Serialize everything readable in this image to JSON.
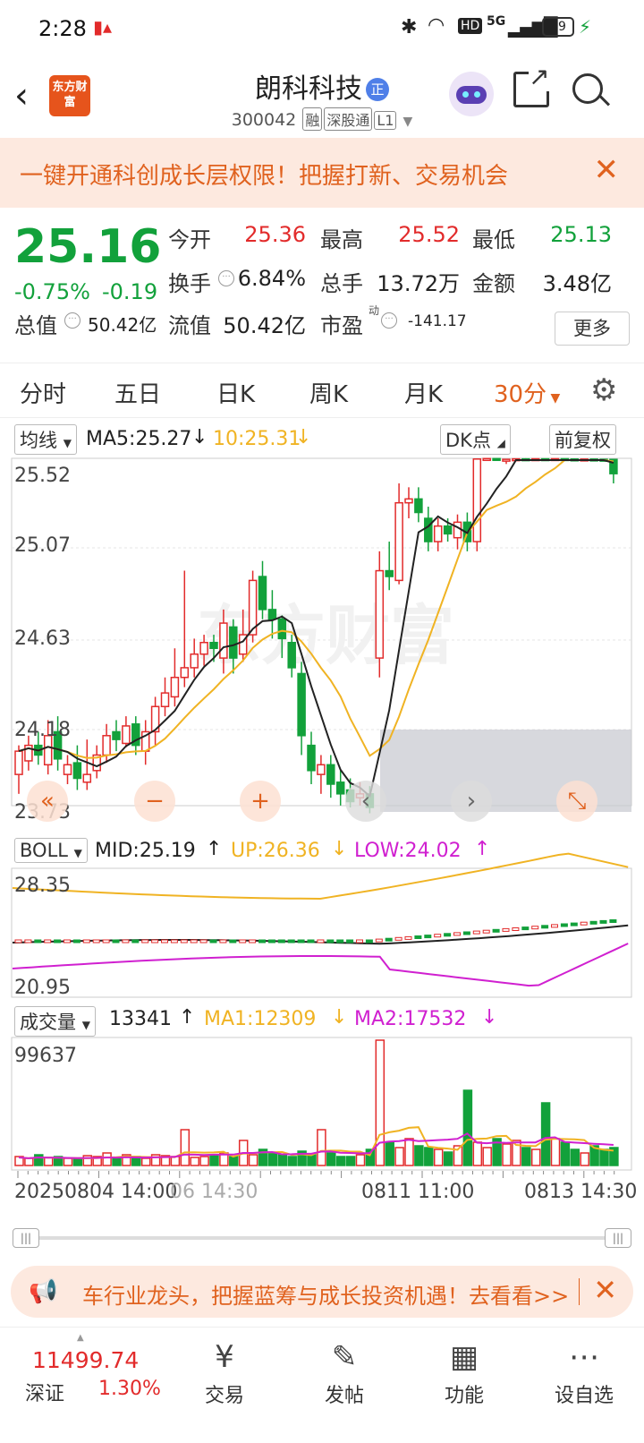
{
  "status_bar": {
    "time": "2:28",
    "network": "5G",
    "battery": "99"
  },
  "header": {
    "logo_text": "东方财富",
    "title": "朗科科技",
    "title_badge": "正",
    "code": "300042",
    "tags": [
      "融",
      "深股通",
      "L1"
    ]
  },
  "banner": {
    "text": "一键开通科创成长层权限！把握打新、交易机会"
  },
  "quote": {
    "price": "25.16",
    "change_pct": "-0.75%",
    "change_amt": "-0.19",
    "open_label": "今开",
    "open": "25.36",
    "high_label": "最高",
    "high": "25.52",
    "low_label": "最低",
    "low": "25.13",
    "turnover_label": "换手",
    "turnover": "6.84%",
    "volume_label": "总手",
    "volume": "13.72万",
    "amount_label": "金额",
    "amount": "3.48亿",
    "mktcap_label": "总值",
    "mktcap": "50.42亿",
    "float_label": "流值",
    "float_cap": "50.42亿",
    "pe_label": "市盈",
    "pe_sup": "动",
    "pe": "-141.17",
    "more": "更多"
  },
  "tabs": [
    "分时",
    "五日",
    "日K",
    "周K",
    "月K",
    "30分"
  ],
  "tabs_active": "30分",
  "main_chart": {
    "indicator": "均线",
    "ma5": "MA5:25.27",
    "ma10": "10:25.31",
    "dk_button": "DK点",
    "adjust_button": "前复权",
    "y_labels": [
      "25.52",
      "25.07",
      "24.63",
      "24.18",
      "23.73"
    ],
    "watermark": "东方财富"
  },
  "boll": {
    "name": "BOLL",
    "mid": "MID:25.19",
    "up": "UP:26.36",
    "low": "LOW:24.02",
    "y_top": "28.35",
    "y_bottom": "20.95"
  },
  "volume": {
    "name": "成交量",
    "value": "13341",
    "ma1": "MA1:12309",
    "ma2": "MA2:17532",
    "y_top": "99637"
  },
  "x_axis": {
    "left": "20250804 14:00",
    "left_overlap": "06 14:30",
    "mid": "0811 11:00",
    "right": "0813 14:30"
  },
  "ad": {
    "text": "车行业龙头，把握蓝筹与成长投资机遇！去看看>>"
  },
  "bottom_nav": {
    "index_value": "11499.74",
    "index_name": "深证",
    "index_pct": "1.30%",
    "items": [
      "交易",
      "发帖",
      "功能",
      "设自选"
    ]
  },
  "colors": {
    "up": "#e22b2b",
    "down": "#12a13b",
    "accent": "#e0621f",
    "ma5": "#222222",
    "ma10": "#f0b323",
    "lower": "#d020d0"
  }
}
